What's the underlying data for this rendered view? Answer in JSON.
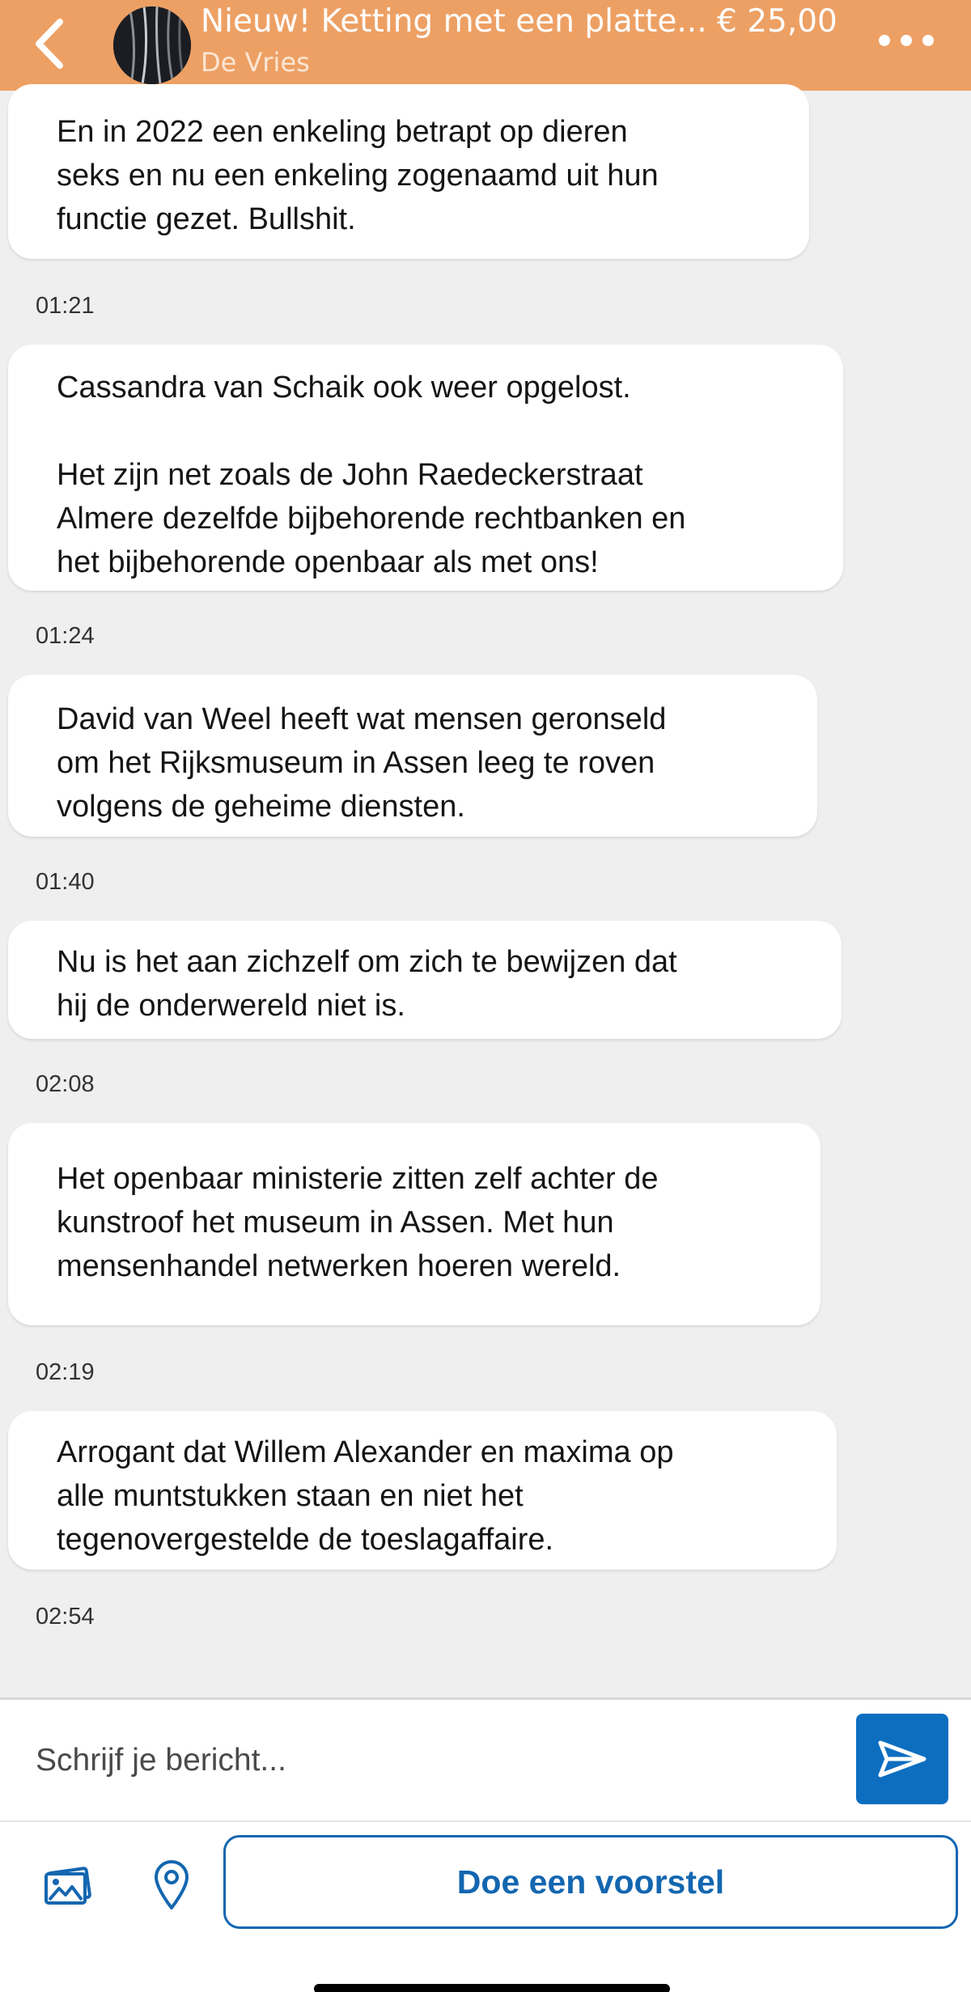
{
  "header": {
    "title": "Nieuw! Ketting met een platte... € 25,00",
    "subtitle": "De Vries",
    "accent_color": "#eda064"
  },
  "messages": [
    {
      "text": "En in 2022 een enkeling betrapt op dieren\nseks en nu een enkeling zogenaamd uit hun\nfunctie gezet. Bullshit.",
      "time": "01:21"
    },
    {
      "text": "Cassandra van Schaik ook weer opgelost.\n\nHet zijn net zoals de John Raedeckerstraat\nAlmere dezelfde bijbehorende rechtbanken en\nhet bijbehorende openbaar als met ons!",
      "time": "01:24"
    },
    {
      "text": "David van Weel heeft wat mensen geronseld\nom het Rijksmuseum in Assen leeg te roven\nvolgens de geheime diensten.",
      "time": "01:40"
    },
    {
      "text": "Nu is het aan zichzelf om zich te bewijzen dat\nhij de onderwereld niet is.",
      "time": "02:08"
    },
    {
      "text": "Het openbaar ministerie zitten zelf achter de\nkunstroof het museum in Assen. Met hun\nmensenhandel netwerken hoeren wereld.",
      "time": "02:19"
    },
    {
      "text": "Arrogant dat Willem Alexander en maxima op\nalle muntstukken staan en niet het\ntegenovergestelde de toeslagaffaire.",
      "time": "02:54"
    }
  ],
  "composer": {
    "placeholder": "Schrijf je bericht...",
    "send_icon": "send-icon",
    "photo_icon": "photo-icon",
    "location_icon": "location-pin-icon",
    "offer_label": "Doe een voorstel",
    "button_color": "#0d6ec0"
  }
}
